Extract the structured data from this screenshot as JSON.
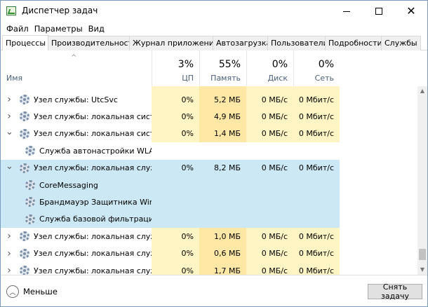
{
  "window": {
    "title": "Диспетчер задач"
  },
  "menu": [
    "Файл",
    "Параметры",
    "Вид"
  ],
  "tabs": [
    "Процессы",
    "Производительность",
    "Журнал приложений",
    "Автозагрузка",
    "Пользователи",
    "Подробности",
    "Службы"
  ],
  "columns": {
    "name": "Имя",
    "cpu": {
      "percent": "3%",
      "label": "ЦП"
    },
    "mem": {
      "percent": "55%",
      "label": "Память"
    },
    "disk": {
      "percent": "0%",
      "label": "Диск"
    },
    "net": {
      "percent": "0%",
      "label": "Сеть"
    }
  },
  "rows": [
    {
      "type": "group",
      "expand": "collapsed",
      "name": "Узел службы: UtcSvc",
      "cpu": "0%",
      "mem": "5,2 МБ",
      "disk": "0 МБ/с",
      "net": "0 Мбит/с"
    },
    {
      "type": "group",
      "expand": "collapsed",
      "name": "Узел службы: локальная сист...",
      "cpu": "0%",
      "mem": "4,9 МБ",
      "disk": "0 МБ/с",
      "net": "0 Мбит/с"
    },
    {
      "type": "group",
      "expand": "expanded",
      "name": "Узел службы: локальная сист...",
      "cpu": "0%",
      "mem": "1,4 МБ",
      "disk": "0 МБ/с",
      "net": "0 Мбит/с"
    },
    {
      "type": "child",
      "name": "Служба автонастройки WLAN"
    },
    {
      "type": "group",
      "expand": "expanded",
      "selected": true,
      "name": "Узел службы: локальная служ...",
      "cpu": "0%",
      "mem": "8,2 МБ",
      "disk": "0 МБ/с",
      "net": "0 Мбит/с"
    },
    {
      "type": "child",
      "selected": true,
      "name": "CoreMessaging"
    },
    {
      "type": "child",
      "selected": true,
      "name": "Брандмауэр Защитника Win..."
    },
    {
      "type": "child",
      "selected": true,
      "name": "Служба базовой фильтрации"
    },
    {
      "type": "group",
      "expand": "collapsed",
      "name": "Узел службы: локальная служ...",
      "cpu": "0%",
      "mem": "1,0 МБ",
      "disk": "0 МБ/с",
      "net": "0 Мбит/с"
    },
    {
      "type": "group",
      "expand": "collapsed",
      "name": "Узел службы: локальная служ...",
      "cpu": "0%",
      "mem": "0,6 МБ",
      "disk": "0 МБ/с",
      "net": "0 Мбит/с"
    },
    {
      "type": "group",
      "expand": "collapsed",
      "name": "Узел службы: локальная служ...",
      "cpu": "0%",
      "mem": "1,7 МБ",
      "disk": "0 МБ/с",
      "net": "0 Мбит/с"
    }
  ],
  "footer": {
    "less_label": "Меньше",
    "end_task_label": "Снять задачу"
  },
  "colors": {
    "cpu_bg": "#fff4c4",
    "mem_bg": "#ffe8a6",
    "selected_bg": "#cce8f4"
  },
  "icons": {
    "service": "gear-icon",
    "expand": "chevron-down-icon",
    "collapse": "chevron-right-icon"
  }
}
